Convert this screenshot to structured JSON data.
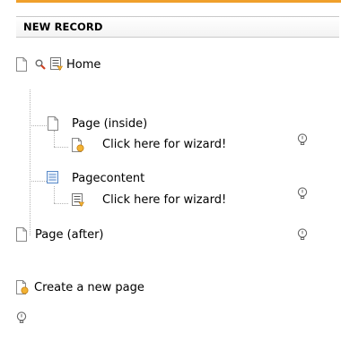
{
  "header": {
    "title": "NEW RECORD"
  },
  "tree": {
    "home_label": "Home",
    "page_inside_label": "Page (inside)",
    "wizard_label_1": "Click here for wizard!",
    "pagecontent_label": "Pagecontent",
    "wizard_label_2": "Click here for wizard!",
    "page_after_label": "Page (after)"
  },
  "footer": {
    "create_page_label": "Create a new page"
  },
  "colors": {
    "accent_orange": "#f0a02b",
    "page_icon_border": "#888888",
    "content_icon_blue": "#5a8ac8"
  },
  "icons": {
    "page": "page-icon",
    "magnifier": "search-icon",
    "list": "content-list-icon",
    "wizard": "page-wizard-icon",
    "help": "help-bulb-icon"
  }
}
